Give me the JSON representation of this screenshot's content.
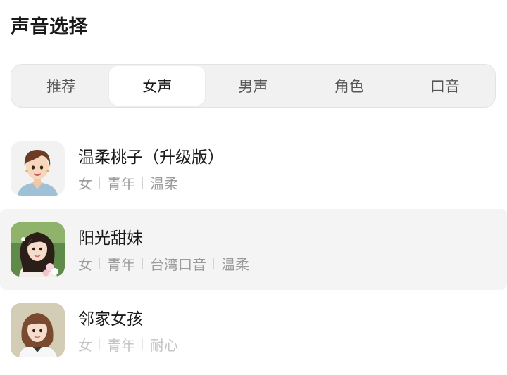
{
  "page": {
    "title": "声音选择"
  },
  "tabs": [
    {
      "label": "推荐",
      "active": false
    },
    {
      "label": "女声",
      "active": true
    },
    {
      "label": "男声",
      "active": false
    },
    {
      "label": "角色",
      "active": false
    },
    {
      "label": "口音",
      "active": false
    }
  ],
  "voices": [
    {
      "name": "温柔桃子（升级版）",
      "tags": [
        "女",
        "青年",
        "温柔"
      ],
      "selected": false
    },
    {
      "name": "阳光甜妹",
      "tags": [
        "女",
        "青年",
        "台湾口音",
        "温柔"
      ],
      "selected": true
    },
    {
      "name": "邻家女孩",
      "tags": [
        "女",
        "青年",
        "耐心"
      ],
      "selected": false
    }
  ],
  "colors": {
    "selected_row": "#f4f4f4",
    "tab_bar": "#f1f1f1",
    "tag_text": "#9b9b9b"
  }
}
